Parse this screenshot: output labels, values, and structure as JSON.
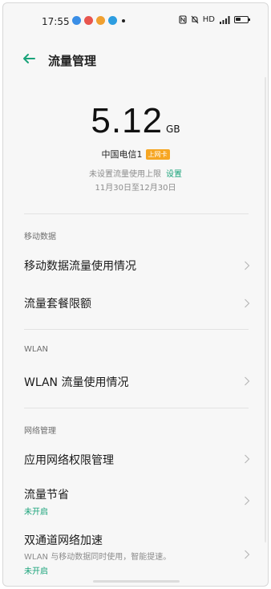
{
  "status_bar": {
    "time": "17:55",
    "network_label": "HD",
    "accent": "#222222"
  },
  "header": {
    "title": "流量管理"
  },
  "usage": {
    "value": "5.12",
    "unit": "GB",
    "carrier": "中国电信1",
    "carrier_badge": "上网卡",
    "limit_text": "未设置流量使用上限",
    "limit_link": "设置",
    "period": "11月30日至12月30日"
  },
  "sections": {
    "mobile": {
      "label": "移动数据",
      "items": [
        {
          "title": "移动数据流量使用情况"
        },
        {
          "title": "流量套餐限额"
        }
      ]
    },
    "wlan": {
      "label": "WLAN",
      "items": [
        {
          "title": "WLAN 流量使用情况"
        }
      ]
    },
    "network": {
      "label": "网络管理",
      "items": [
        {
          "title": "应用网络权限管理"
        },
        {
          "title": "流量节省",
          "status": "未开启"
        },
        {
          "title": "双通道网络加速",
          "subtitle": "WLAN 与移动数据同时使用，智能提速。",
          "status": "未开启"
        }
      ]
    }
  },
  "colors": {
    "accent_green": "#1aa37a",
    "badge_orange": "#f6a623",
    "background": "#f7f7f7"
  },
  "icons": [
    "back-arrow-icon",
    "chevron-right-icon",
    "battery-icon",
    "signal-icon"
  ]
}
